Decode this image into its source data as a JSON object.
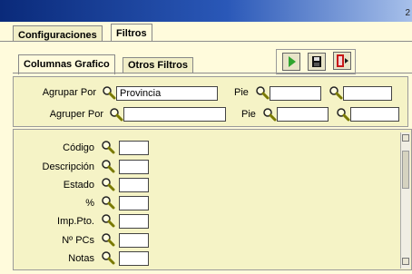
{
  "window": {
    "title_fragment": "2"
  },
  "tabs_top": [
    "Configuraciones",
    "Filtros"
  ],
  "tabs_inner": [
    "Columnas Grafico",
    "Otros Filtros"
  ],
  "toolbar": {
    "buttons": [
      "play-icon",
      "save-icon",
      "exit-door-icon"
    ]
  },
  "group": {
    "agrupar_label": "Agrupar Por",
    "agrupar_value": "Provincia",
    "agruper_label": "Agruper Por",
    "pie_label_1": "Pie",
    "pie_label_2": "Pie"
  },
  "fields": [
    {
      "label": "Código"
    },
    {
      "label": "Descripción"
    },
    {
      "label": "Estado"
    },
    {
      "label": "%"
    },
    {
      "label": "Imp.Pto."
    },
    {
      "label": "Nº PCs"
    },
    {
      "label": "Notas"
    }
  ],
  "colors": {
    "title_start": "#0a2a7a",
    "title_end": "#a7c0ea",
    "panel_bg": "#fffbdc",
    "box_bg": "#f5f3c6",
    "play_green": "#2fa52f",
    "exit_red": "#c81818"
  }
}
